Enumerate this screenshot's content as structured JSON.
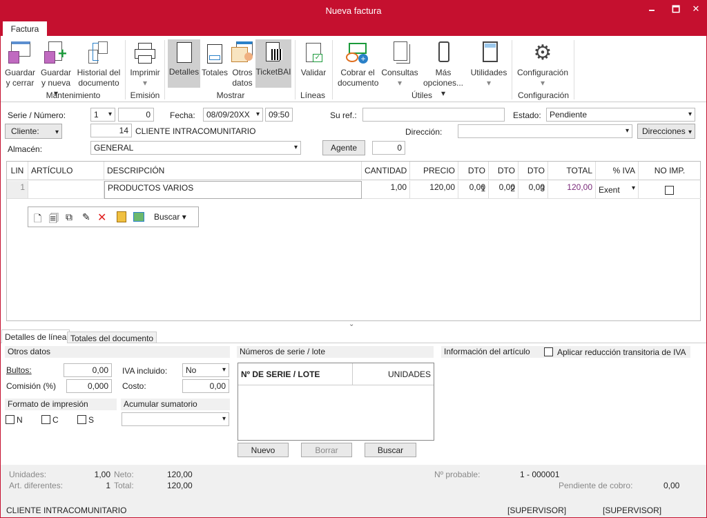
{
  "window": {
    "title": "Nueva factura",
    "minimize": "🗕",
    "maximize": "🗖",
    "close": "✕"
  },
  "ribbon": {
    "tab": "Factura",
    "buttons": [
      {
        "id": "guardar-cerrar",
        "l1": "Guardar",
        "l2": "y cerrar"
      },
      {
        "id": "guardar-nueva",
        "l1": "Guardar",
        "l2": "y nueva ▾"
      },
      {
        "id": "historial",
        "l1": "Historial del",
        "l2": "documento"
      },
      {
        "id": "imprimir",
        "l1": "Imprimir",
        "l2": "▾"
      },
      {
        "id": "detalles",
        "l1": "Detalles",
        "l2": ""
      },
      {
        "id": "totales",
        "l1": "Totales",
        "l2": ""
      },
      {
        "id": "otros-datos",
        "l1": "Otros",
        "l2": "datos"
      },
      {
        "id": "ticketbai",
        "l1": "TicketBAI",
        "l2": ""
      },
      {
        "id": "validar",
        "l1": "Validar",
        "l2": ""
      },
      {
        "id": "cobrar",
        "l1": "Cobrar el",
        "l2": "documento"
      },
      {
        "id": "consultas",
        "l1": "Consultas",
        "l2": "▾"
      },
      {
        "id": "mas-opciones",
        "l1": "Más",
        "l2": "opciones... ▾"
      },
      {
        "id": "utilidades",
        "l1": "Utilidades",
        "l2": "▾"
      },
      {
        "id": "configuracion",
        "l1": "Configuración",
        "l2": "▾"
      }
    ],
    "groups": [
      "Mantenimiento",
      "Emisión",
      "Mostrar",
      "Líneas",
      "Útiles",
      "Configuración"
    ]
  },
  "header": {
    "serie_label": "Serie / Número:",
    "serie": "1",
    "numero": "0",
    "fecha_label": "Fecha:",
    "fecha": "08/09/20XX",
    "hora": "09:50",
    "suref_label": "Su ref.:",
    "suref": "",
    "estado_label": "Estado:",
    "estado": "Pendiente",
    "cliente_label": "Cliente:",
    "cliente_code": "14",
    "cliente_name": "CLIENTE INTRACOMUNITARIO",
    "direccion_label": "Dirección:",
    "direccion": "",
    "direcciones_btn": "Direcciones",
    "almacen_label": "Almacén:",
    "almacen": "GENERAL",
    "agente_btn": "Agente",
    "agente": "0"
  },
  "grid": {
    "columns": [
      "LIN",
      "ARTÍCULO",
      "DESCRIPCIÓN",
      "CANTIDAD",
      "PRECIO",
      "DTO 1",
      "DTO 2",
      "DTO 3",
      "TOTAL",
      "% IVA",
      "NO IMP."
    ],
    "rows": [
      {
        "lin": "1",
        "articulo": "",
        "descripcion": "PRODUCTOS VARIOS",
        "cantidad": "1,00",
        "precio": "120,00",
        "dto1": "0,00",
        "dto2": "0,00",
        "dto3": "0,00",
        "total": "120,00",
        "iva": "Exent",
        "noimp": false
      }
    ],
    "toolbar_buscar": "Buscar"
  },
  "bottom_tabs": [
    "Detalles de línea",
    "Totales del documento"
  ],
  "detalles": {
    "otros_datos": "Otros datos",
    "bultos_label": "Bultos:",
    "bultos": "0,00",
    "comision_label": "Comisión (%)",
    "comision": "0,000",
    "iva_incl_label": "IVA incluido:",
    "iva_incl": "No",
    "costo_label": "Costo:",
    "costo": "0,00",
    "formato_label": "Formato de impresión",
    "formato_opts": [
      "N",
      "C",
      "S"
    ],
    "acumular_label": "Acumular sumatorio",
    "acumular": "",
    "series_label": "Números de serie / lote",
    "series_cols": [
      "Nº DE SERIE / LOTE",
      "UNIDADES"
    ],
    "nuevo": "Nuevo",
    "borrar": "Borrar",
    "buscar": "Buscar",
    "info_label": "Información del artículo",
    "reduccion_label": "Aplicar reducción transitoria de IVA"
  },
  "footer": {
    "unidades_label": "Unidades:",
    "unidades": "1,00",
    "neto_label": "Neto:",
    "neto": "120,00",
    "art_label": "Art. diferentes:",
    "art": "1",
    "total_label": "Total:",
    "total": "120,00",
    "probable_label": "Nº probable:",
    "probable": "1 - 000001",
    "pendiente_label": "Pendiente de cobro:",
    "pendiente": "0,00",
    "status_cliente": "CLIENTE INTRACOMUNITARIO",
    "status_user1": "[SUPERVISOR]",
    "status_user2": "[SUPERVISOR]"
  },
  "colors": {
    "accent": "#c5102f",
    "price": "#7a2a7a"
  }
}
